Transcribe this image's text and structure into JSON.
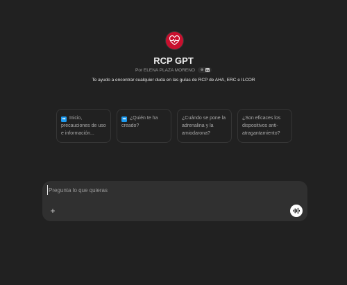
{
  "gpt": {
    "title": "RCP GPT",
    "author": "Por ELENA PLAZA MORENO",
    "description": "Te ayudo a encontrar cualquier duda en las guías de RCP de AHA, ERC e ILCOR",
    "logo_icon": "heart-lifeline-logo",
    "brand_color": "#c8102e"
  },
  "author_badges": [
    {
      "icon": "globe-icon",
      "glyph": "⊕"
    },
    {
      "icon": "linkedin-icon",
      "glyph": "in"
    }
  ],
  "starters": [
    {
      "emoji": "➡",
      "text": " Inicio, precauciones de uso e información..."
    },
    {
      "emoji": "➡",
      "text": " ¿Quién te ha creado?"
    },
    {
      "emoji": "",
      "text": "¿Cuándo se pone la adrenalina y la amiodarona?"
    },
    {
      "emoji": "",
      "text": "¿Son eficaces los dispositivos anti-atragantamiento?"
    }
  ],
  "composer": {
    "placeholder": "Pregunta lo que quieras",
    "value": "",
    "attach_glyph": "+",
    "attach_icon": "plus-icon",
    "voice_icon": "voice-waveform-icon"
  }
}
